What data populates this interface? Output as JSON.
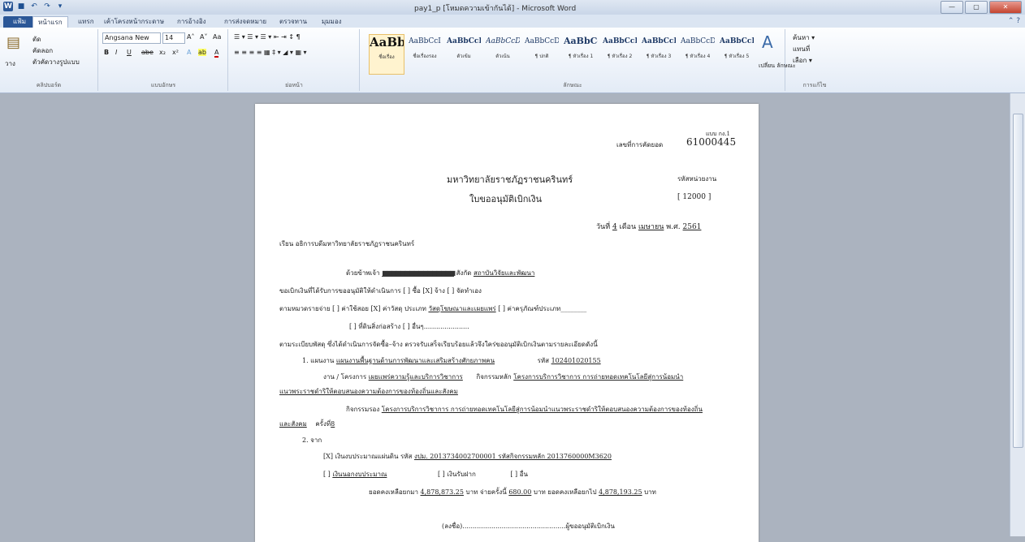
{
  "window": {
    "title": "pay1_p [โหมดความเข้ากันได้] - Microsoft Word",
    "minimize": "—",
    "maximize": "▢",
    "close": "✕"
  },
  "qat": {
    "app": "W",
    "save": "■",
    "undo": "↶",
    "redo": "↷",
    "more": "▾"
  },
  "tabs": [
    "แฟ้ม",
    "หน้าแรก",
    "แทรก",
    "เค้าโครงหน้ากระดาษ",
    "การอ้างอิง",
    "การส่งจดหมาย",
    "ตรวจทาน",
    "มุมมอง"
  ],
  "help": "⌃ ?",
  "ribbon": {
    "clipboard": {
      "paste": "วาง",
      "cut": "ตัด",
      "copy": "คัดลอก",
      "format_painter": "ตัวคัดวางรูปแบบ",
      "label": "คลิปบอร์ด"
    },
    "font": {
      "name": "Angsana New",
      "size": "14",
      "grow": "A˄",
      "shrink": "A˅",
      "case": "Aa",
      "clear": "⌫",
      "bold": "B",
      "italic": "I",
      "underline": "U",
      "strike": "abe",
      "sub": "x₂",
      "sup": "x²",
      "effects": "A",
      "highlight": "ab",
      "color": "A",
      "label": "แบบอักษร"
    },
    "paragraph": {
      "row1": "☰ ▾  ☰ ▾  ☰ ▾   ⇤  ⇥   ↕   ¶",
      "row2": "≡  ≡  ≡  ≡  ▦   ‡ ▾   ◢ ▾  ▦ ▾",
      "label": "ย่อหน้า"
    },
    "styles": {
      "items": [
        {
          "sample": "AaBb(",
          "label": "ชื่อเรื่อง"
        },
        {
          "sample": "AaBbCcI",
          "label": "ชื่อเรื่องรอง"
        },
        {
          "sample": "AaBbCcDd",
          "label": "ตัวเข้ม"
        },
        {
          "sample": "AaBbCcDd",
          "label": "ตัวเน้น"
        },
        {
          "sample": "AaBbCcDd",
          "label": "¶ ปกติ"
        },
        {
          "sample": "AaBbCc.",
          "label": "¶ หัวเรื่อง 1"
        },
        {
          "sample": "AaBbCcD",
          "label": "¶ หัวเรื่อง 2"
        },
        {
          "sample": "AaBbCcD",
          "label": "¶ หัวเรื่อง 3"
        },
        {
          "sample": "AaBbCcD",
          "label": "¶ หัวเรื่อง 4"
        },
        {
          "sample": "AaBbCcDd",
          "label": "¶ หัวเรื่อง 5"
        }
      ],
      "change": "เปลี่ยน\nลักษณะ",
      "label": "ลักษณะ"
    },
    "editing": {
      "find": "ค้นหา ▾",
      "replace": "แทนที่",
      "select": "เลือก ▾",
      "label": "การแก้ไข"
    }
  },
  "document": {
    "form_code": "แบบ กง.1",
    "control_no_label": "เลขที่การคัดยอด",
    "control_no": "61000445",
    "university": "มหาวิทยาลัยราชภัฏราชนครินทร์",
    "unit_code_label": "รหัสหน่วยงาน",
    "form_title": "ใบขออนุมัติเบิกเงิน",
    "unit_code": "[ 12000 ]",
    "date_prefix": "วันที่",
    "day": "4",
    "month_label": "เดือน",
    "month": "เมษายน",
    "year_label": "พ.ศ.",
    "year": "2561",
    "to_line": "เรียน   อธิการบดีมหาวิทยาลัยราชภัฏราชนครินทร์",
    "requester_prefix": "ด้วยข้าพเจ้า",
    "requester_name": "■■■■■■■■■■■■■■■■",
    "affiliation_label": "สังกัด",
    "affiliation": "สถาบันวิจัยและพัฒนา",
    "line_request": "ขอเบิกเงินที่ได้รับการขออนุมัติให้ดำเนินการ   [ ] ซื้อ        [X] จ้าง        [ ] จัดทำเอง",
    "line_category_a": "ตามหมวดรายจ่าย [ ] ค่าใช้สอย  [X] ค่าวัสดุ ประเภท",
    "line_category_material": "วัสดุโฆษณาและเผยแพร่",
    "line_category_b": "[ ] ค่าครุภัณฑ์ประเภท________",
    "line_category_c": "[ ] ที่ดินสิ่งก่อสร้าง   [ ] อื่นๆ......................",
    "line_regulation": "ตามระเบียบพัสดุ ซึ่งได้ดำเนินการจัดซื้อ–จ้าง ตรวจรับเสร็จเรียบร้อยแล้วจึงใคร่ขออนุมัติเบิกเงินตามรายละเอียดดังนี้",
    "plan_prefix": "1. แผนงาน",
    "plan": "แผนงานพื้นฐานด้านการพัฒนาและเสริมสร้างศักยภาพคน",
    "plan_code_label": "รหัส",
    "plan_code": "102401020155",
    "project_prefix": "งาน / โครงการ",
    "project": "เผยแพร่ความรู้และบริการวิชาการ",
    "main_activity_label": "กิจกรรมหลัก",
    "main_activity": "โครงการบริการวิชาการ การถ่ายทอดเทคโนโลยีสู่การน้อมนำ",
    "main_activity_cont": "แนวพระราชดำริให้ตอบสนองความต้องการของท้องถิ่นและสังคม",
    "sub_activity_label": "กิจกรรมรอง",
    "sub_activity": "โครงการบริการวิชาการ การถ่ายทอดเทคโนโลยีสู่การน้อมนำแนวพระราชดำริให้ตอบสนองความต้องการของท้องถิ่น",
    "sub_activity_cont": "และสังคม",
    "round_label": "ครั้งที่",
    "round": "8",
    "source_label": "2. จาก",
    "budget_a": "[X] เงินงบประมาณแผ่นดิน  รหัส",
    "budget_code": "งปม. 2013734002700001  รหัสกิจกรรมหลัก 2013760000M3620",
    "budget_b": "[ ]",
    "budget_b_text": "เงินนอกงบประมาณ",
    "budget_c": "[ ] เงินรับฝาก",
    "budget_d": "[ ] อื่น",
    "balance_fwd_label": "ยอดคงเหลือยกมา",
    "balance_fwd": "4,878,873.25",
    "baht1": "บาท  จ่ายครั้งนี้",
    "pay_now": "680.00",
    "baht2": "บาท   ยอดคงเหลือยกไป",
    "balance_next": "4,878,193.25",
    "baht3": "บาท",
    "sign_line": "(ลงชื่อ)..................................................ผู้ขออนุมัติเบิกเงิน"
  }
}
